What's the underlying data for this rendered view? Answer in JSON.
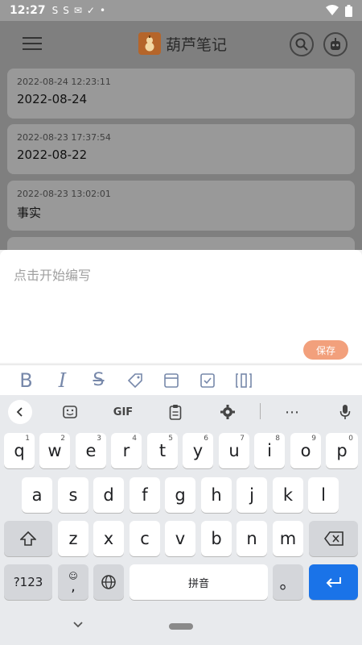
{
  "status_bar": {
    "time": "12:27",
    "icons": [
      "S",
      "S",
      "✉",
      "✓",
      "•"
    ],
    "right_icons": [
      "wifi",
      "battery"
    ]
  },
  "app": {
    "title": "葫芦笔记",
    "logo_glyph": "🎃"
  },
  "notes": [
    {
      "date": "2022-08-24 12:23:11",
      "title": "2022-08-24"
    },
    {
      "date": "2022-08-23 17:37:54",
      "title": "2022-08-22"
    },
    {
      "date": "2022-08-23 13:02:01",
      "title": "事实"
    }
  ],
  "editor": {
    "placeholder": "点击开始编写",
    "save_label": "保存"
  },
  "format_toolbar": [
    "B",
    "I",
    "S",
    "tag",
    "card",
    "checklist",
    "columns"
  ],
  "keyboard": {
    "toolbar": {
      "gif": "GIF"
    },
    "row1": [
      [
        "q",
        "1"
      ],
      [
        "w",
        "2"
      ],
      [
        "e",
        "3"
      ],
      [
        "r",
        "4"
      ],
      [
        "t",
        "5"
      ],
      [
        "y",
        "6"
      ],
      [
        "u",
        "7"
      ],
      [
        "i",
        "8"
      ],
      [
        "o",
        "9"
      ],
      [
        "p",
        "0"
      ]
    ],
    "row2": [
      "a",
      "s",
      "d",
      "f",
      "g",
      "h",
      "j",
      "k",
      "l"
    ],
    "row3": [
      "z",
      "x",
      "c",
      "v",
      "b",
      "n",
      "m"
    ],
    "bottom": {
      "symbols": "?123",
      "comma": ",",
      "space": "拼音",
      "period": "。"
    }
  }
}
